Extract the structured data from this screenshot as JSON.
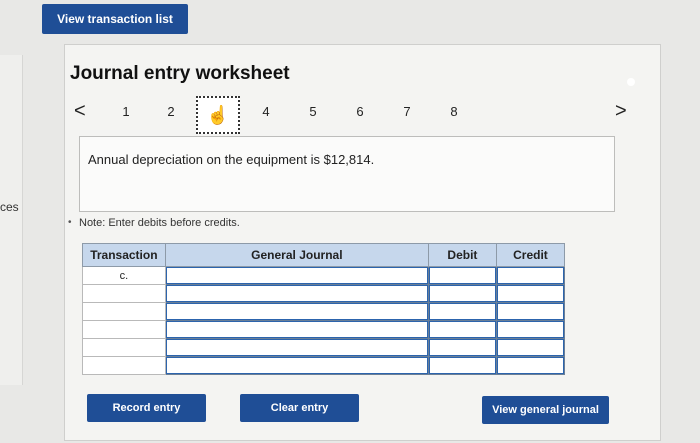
{
  "top": {
    "view_transaction_list": "View transaction list"
  },
  "side": {
    "cut_label": "ces"
  },
  "worksheet": {
    "title": "Journal entry worksheet",
    "nav": {
      "prev": "<",
      "next": ">",
      "pages": [
        "1",
        "2",
        "3",
        "4",
        "5",
        "6",
        "7",
        "8"
      ],
      "active_index": 2
    },
    "description": "Annual depreciation on the equipment is $12,814.",
    "note": "Note: Enter debits before credits."
  },
  "table": {
    "headers": {
      "transaction": "Transaction",
      "general_journal": "General Journal",
      "debit": "Debit",
      "credit": "Credit"
    },
    "rows": [
      {
        "transaction": "c.",
        "account": "",
        "debit": "",
        "credit": ""
      },
      {
        "transaction": "",
        "account": "",
        "debit": "",
        "credit": ""
      },
      {
        "transaction": "",
        "account": "",
        "debit": "",
        "credit": ""
      },
      {
        "transaction": "",
        "account": "",
        "debit": "",
        "credit": ""
      },
      {
        "transaction": "",
        "account": "",
        "debit": "",
        "credit": ""
      },
      {
        "transaction": "",
        "account": "",
        "debit": "",
        "credit": ""
      }
    ]
  },
  "buttons": {
    "record_entry": "Record entry",
    "clear_entry": "Clear entry",
    "view_general_journal": "View general journal"
  },
  "colors": {
    "primary_button": "#1f4e96",
    "table_header": "#c6d7ec"
  }
}
